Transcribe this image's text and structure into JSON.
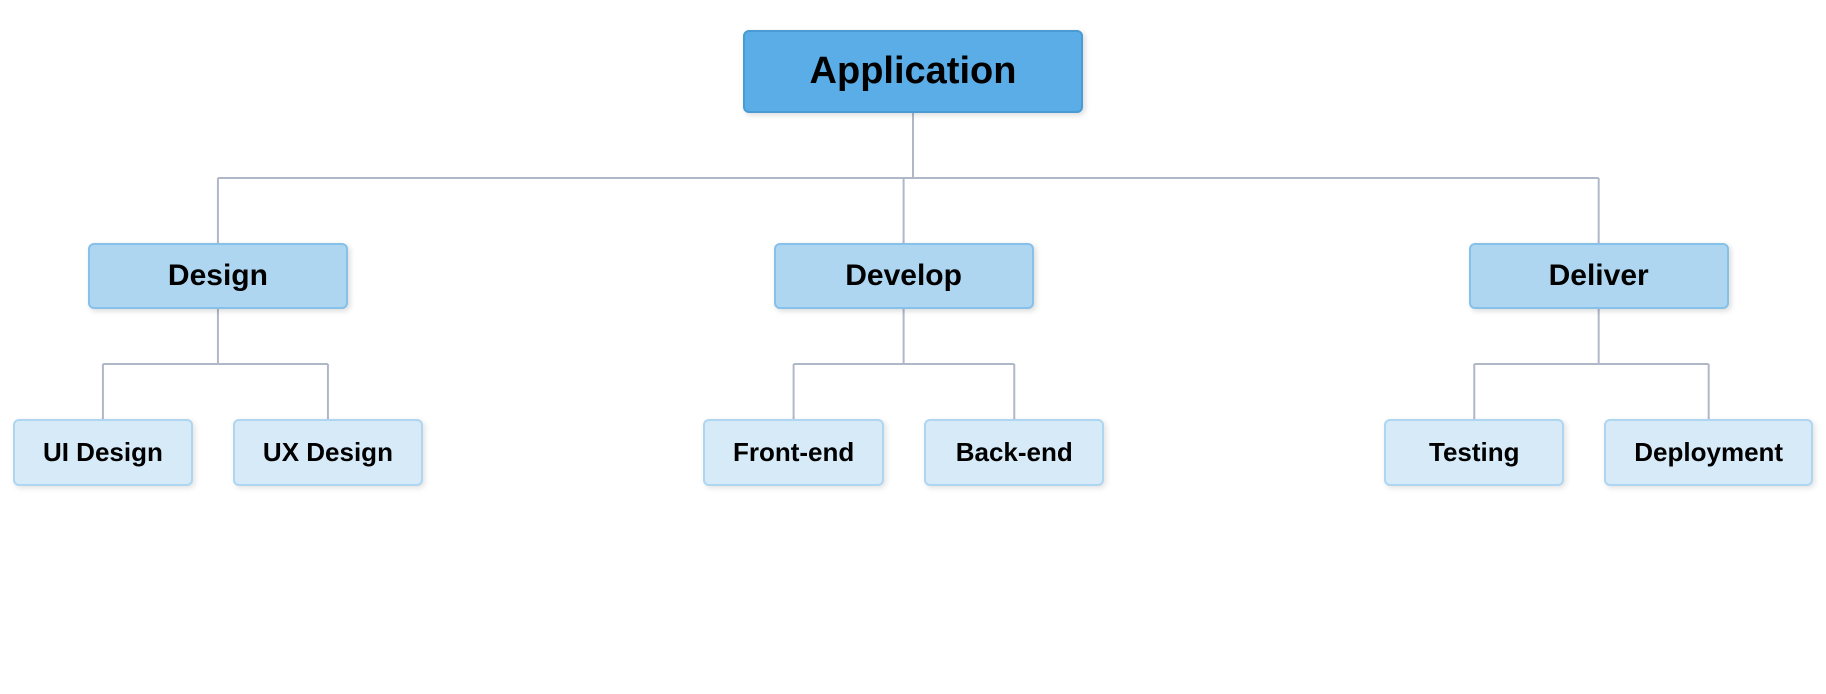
{
  "root": {
    "label": "Application"
  },
  "level2": [
    {
      "label": "Design"
    },
    {
      "label": "Develop"
    },
    {
      "label": "Deliver"
    }
  ],
  "leaves": [
    [
      {
        "label": "UI Design"
      },
      {
        "label": "UX Design"
      }
    ],
    [
      {
        "label": "Front-end"
      },
      {
        "label": "Back-end"
      }
    ],
    [
      {
        "label": "Testing"
      },
      {
        "label": "Deployment"
      }
    ]
  ],
  "colors": {
    "root_bg": "#5aade6",
    "level2_bg": "#aed6f1",
    "leaf_bg": "#d6eaf8",
    "connector": "#b0b8c8"
  }
}
